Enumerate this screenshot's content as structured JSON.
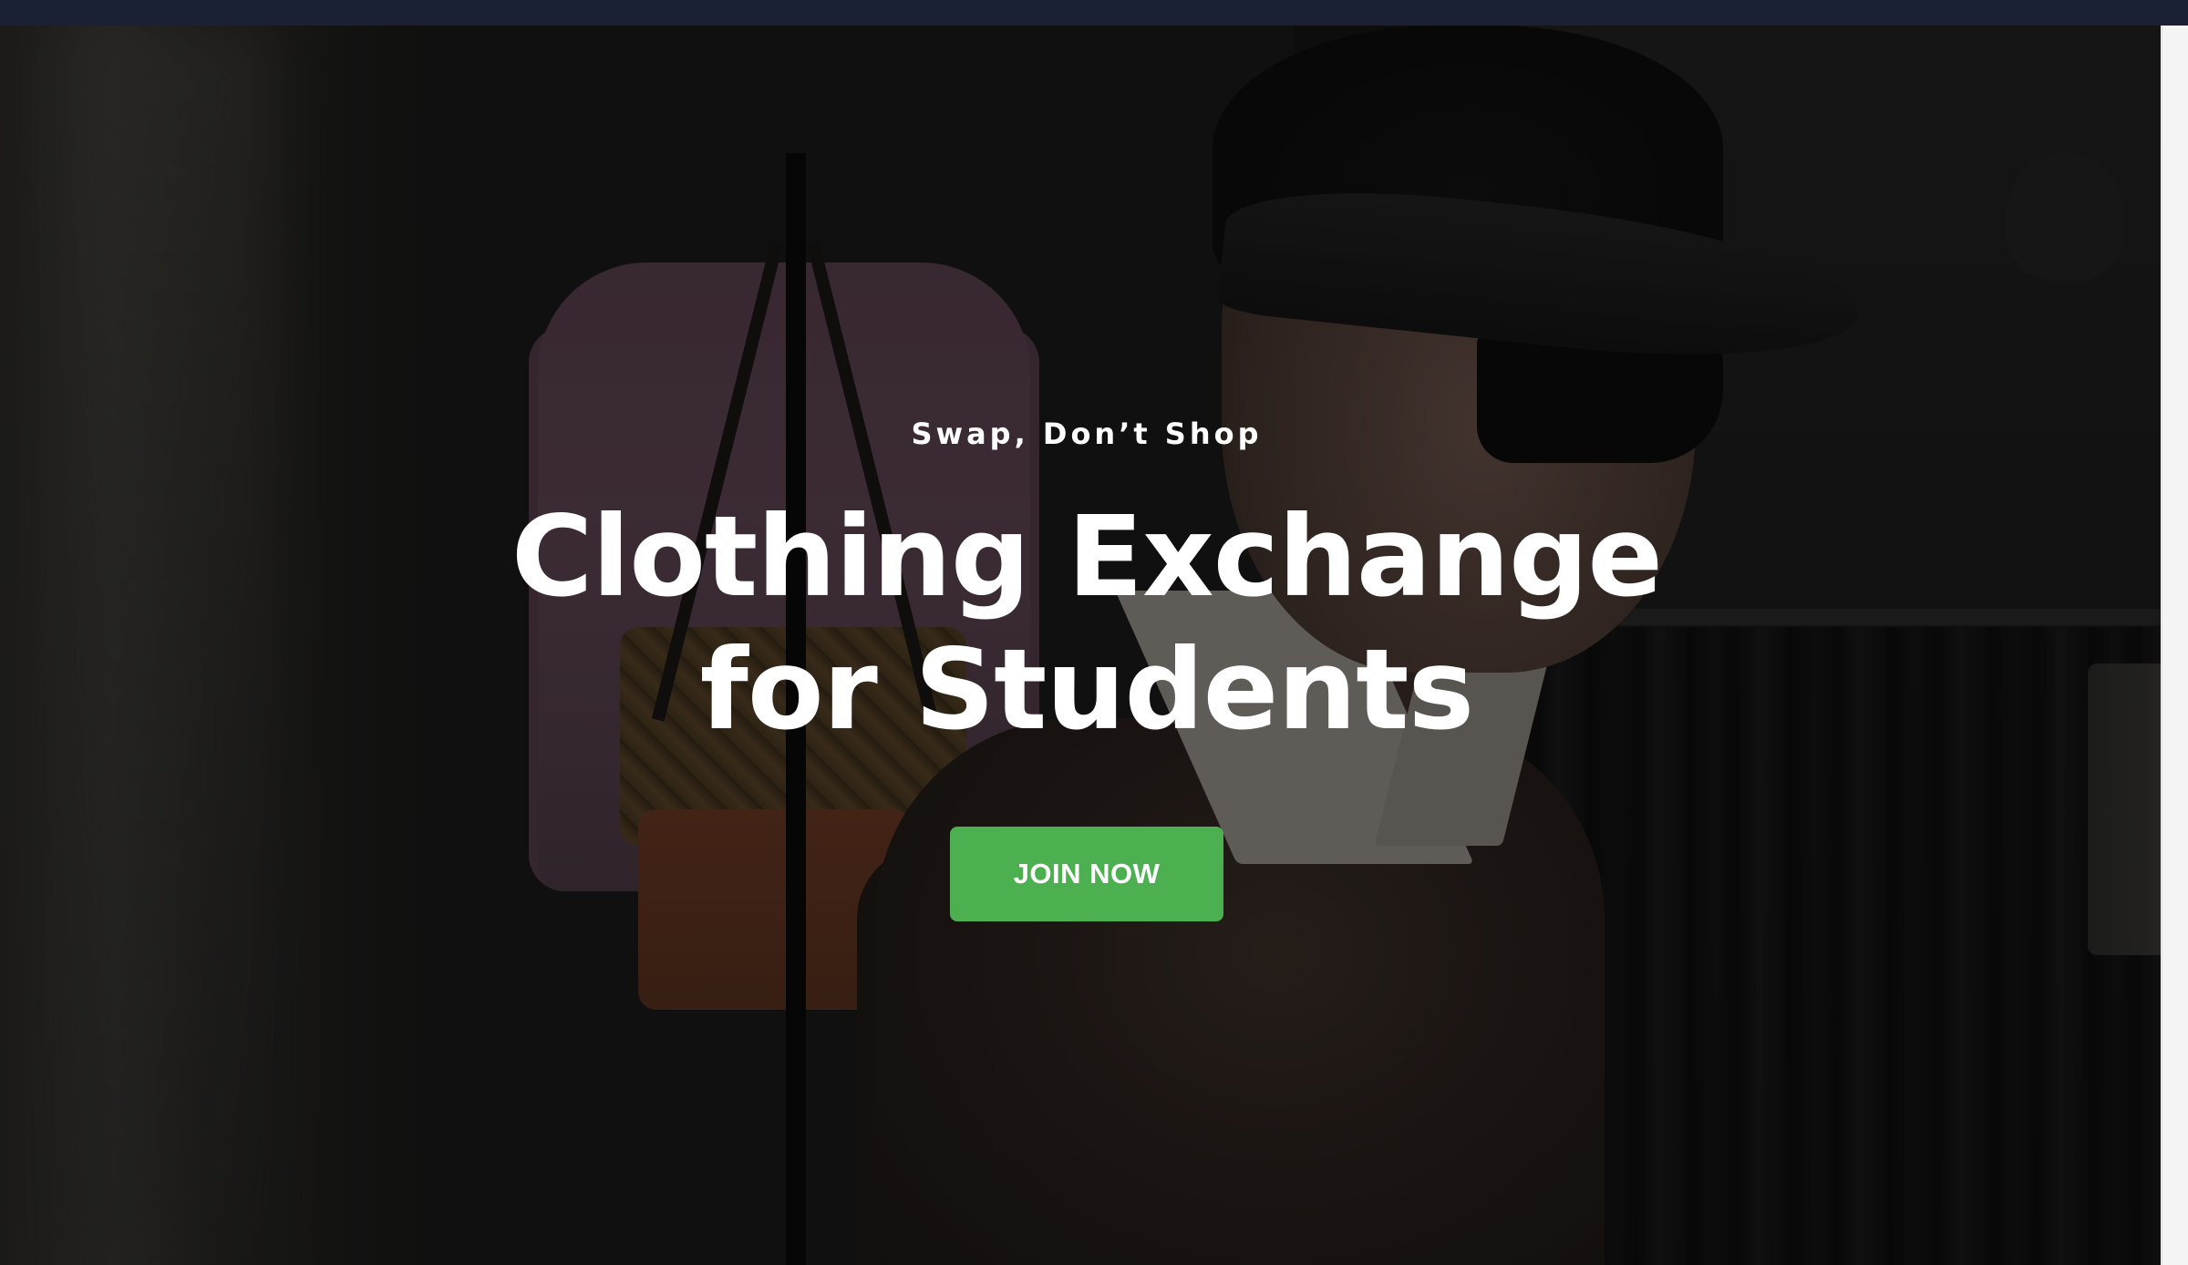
{
  "hero": {
    "tagline": "Swap, Don’t Shop",
    "headline": "Clothing Exchange for Students",
    "cta_label": "JOIN NOW"
  },
  "colors": {
    "top_bar": "#1b2135",
    "cta_background": "#4caf50",
    "text": "#ffffff"
  }
}
